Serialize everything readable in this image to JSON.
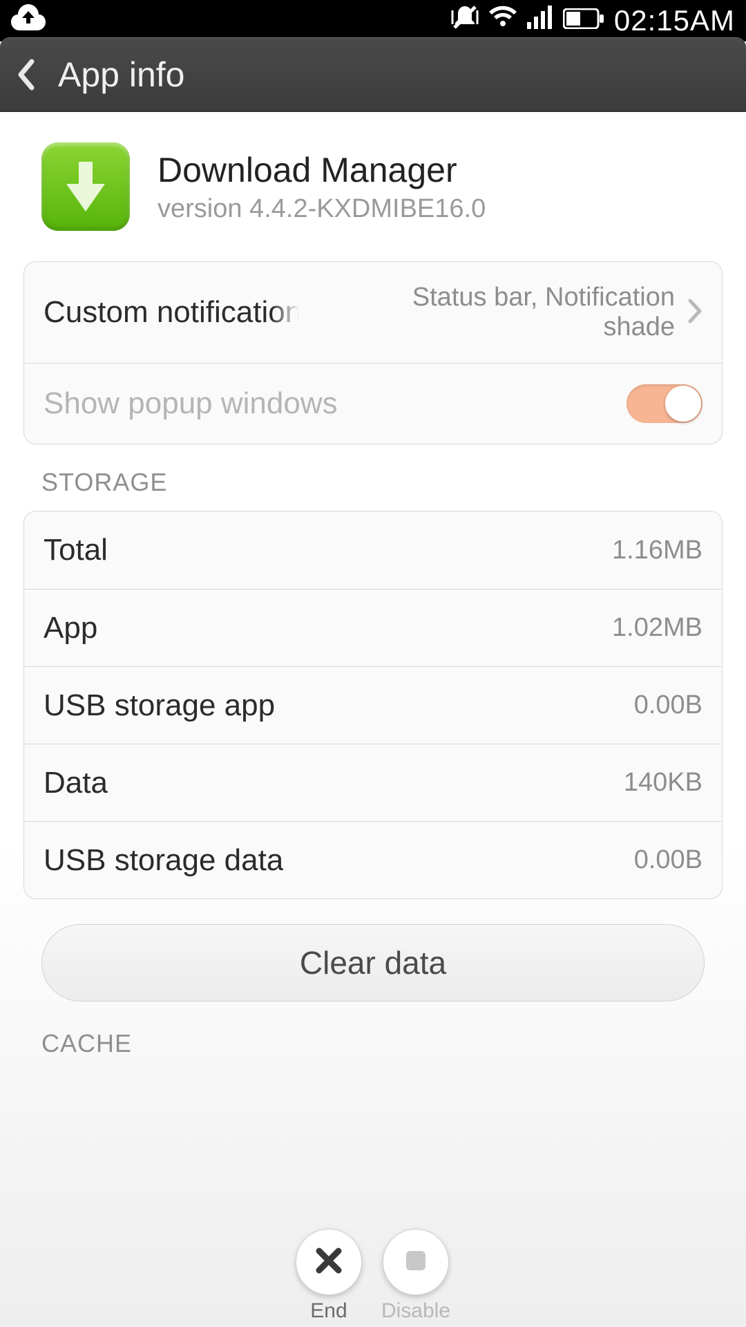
{
  "status": {
    "time": "02:15AM"
  },
  "header": {
    "title": "App info"
  },
  "app": {
    "name": "Download Manager",
    "version": "version 4.4.2-KXDMIBE16.0"
  },
  "settings": {
    "custom_notif": {
      "label": "Custom notifications",
      "value": "Status bar, Notification shade"
    },
    "popup": {
      "label": "Show popup windows",
      "on": true
    }
  },
  "storage": {
    "title": "STORAGE",
    "rows": [
      {
        "label": "Total",
        "value": "1.16MB"
      },
      {
        "label": "App",
        "value": "1.02MB"
      },
      {
        "label": "USB storage app",
        "value": "0.00B"
      },
      {
        "label": "Data",
        "value": "140KB"
      },
      {
        "label": "USB storage data",
        "value": "0.00B"
      }
    ],
    "clear_button": "Clear data"
  },
  "cache": {
    "title": "CACHE"
  },
  "dock": {
    "end": "End",
    "disable": "Disable"
  }
}
